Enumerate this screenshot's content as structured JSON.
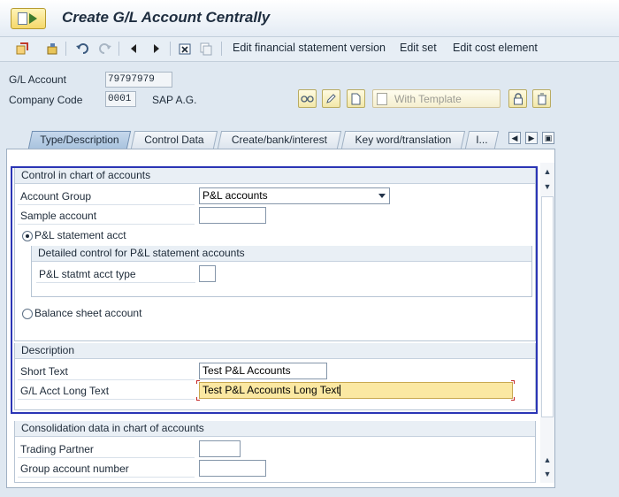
{
  "window": {
    "title": "Create G/L Account Centrally"
  },
  "toolbar": {
    "items": [
      "Edit financial statement version",
      "Edit set",
      "Edit cost element"
    ]
  },
  "header": {
    "gl_account_label": "G/L Account",
    "gl_account_value": "79797979",
    "company_code_label": "Company Code",
    "company_code_value": "0001",
    "company_name": "SAP A.G.",
    "with_template_label": "With Template"
  },
  "tabs": [
    {
      "label": "Type/Description",
      "active": true
    },
    {
      "label": "Control Data",
      "active": false
    },
    {
      "label": "Create/bank/interest",
      "active": false
    },
    {
      "label": "Key word/translation",
      "active": false
    },
    {
      "label": "I...",
      "active": false
    }
  ],
  "control_section": {
    "title": "Control in chart of accounts",
    "account_group_label": "Account Group",
    "account_group_value": "P&L accounts",
    "sample_account_label": "Sample account",
    "sample_account_value": "",
    "pl_radio_label": "P&L statement acct",
    "pl_radio_selected": true,
    "detail_title": "Detailed control for P&L statement accounts",
    "pl_type_label": "P&L statmt acct type",
    "pl_type_value": "",
    "bs_radio_label": "Balance sheet account",
    "bs_radio_selected": false
  },
  "description_section": {
    "title": "Description",
    "short_text_label": "Short Text",
    "short_text_value": "Test P&L Accounts",
    "long_text_label": "G/L Acct Long Text",
    "long_text_value": "Test P&L Accounts Long Text"
  },
  "consolidation_section": {
    "title": "Consolidation data in chart of accounts",
    "trading_partner_label": "Trading Partner",
    "trading_partner_value": "",
    "group_account_label": "Group account number",
    "group_account_value": ""
  },
  "colors": {
    "highlight_border": "#2b35b5",
    "focus_field": "#fbe8a2",
    "active_tab": "#a9c3de"
  }
}
